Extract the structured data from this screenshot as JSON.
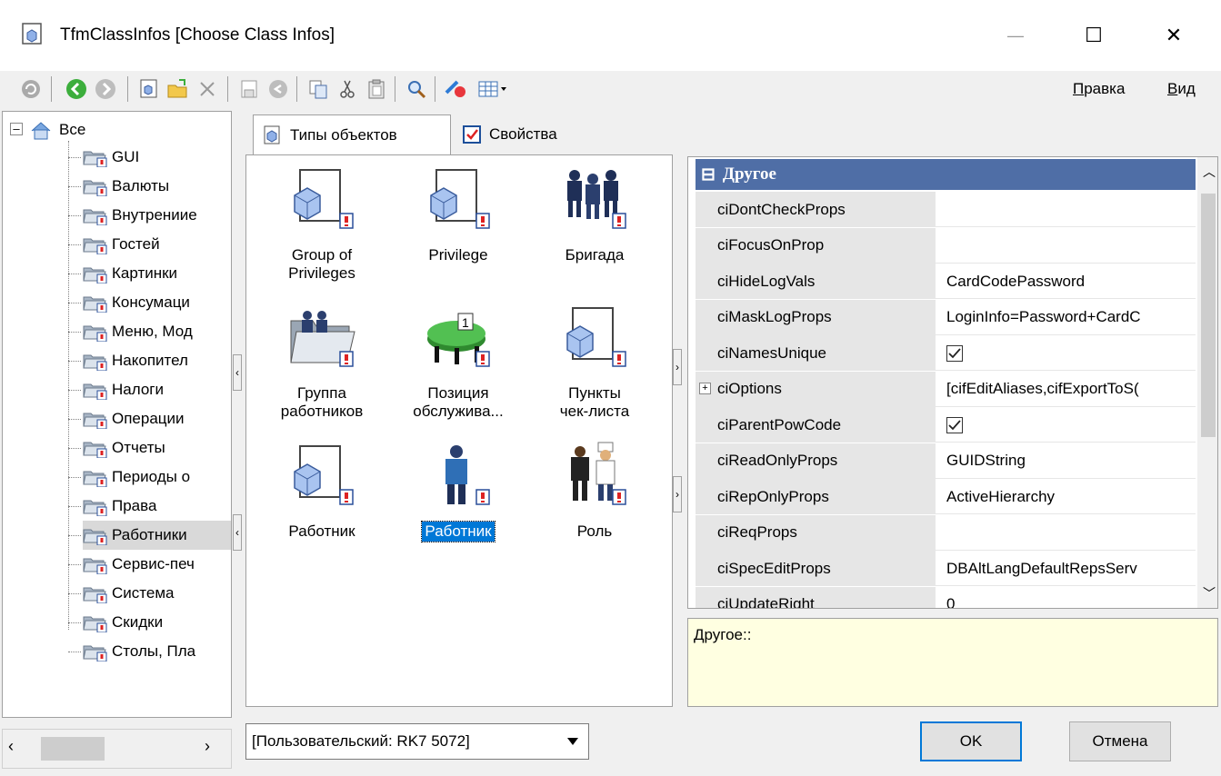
{
  "window": {
    "title": "TfmClassInfos [Choose Class Infos]",
    "minimize_glyph": "—",
    "maximize_glyph": "☐",
    "close_glyph": "✕"
  },
  "toolbar": {
    "buttons": [
      {
        "icon": "refresh-icon"
      },
      {
        "icon": "back-icon"
      },
      {
        "icon": "forward-icon"
      },
      {
        "icon": "class-object-icon"
      },
      {
        "icon": "open-folder-icon"
      },
      {
        "icon": "delete-icon"
      },
      {
        "icon": "save-icon"
      },
      {
        "icon": "undo-icon"
      },
      {
        "icon": "copy-icon"
      },
      {
        "icon": "cut-icon"
      },
      {
        "icon": "paste-icon"
      },
      {
        "icon": "find-icon"
      },
      {
        "icon": "paint-icon"
      },
      {
        "icon": "view-grid-icon"
      }
    ],
    "menu_edit_hotkey": "П",
    "menu_edit_rest": "равка",
    "menu_view_hotkey": "В",
    "menu_view_rest": "ид"
  },
  "tree": {
    "root": {
      "label": "Все"
    },
    "items": [
      {
        "label": "GUI"
      },
      {
        "label": "Валюты"
      },
      {
        "label": "Внутрениие"
      },
      {
        "label": "Гостей"
      },
      {
        "label": "Картинки"
      },
      {
        "label": "Консумаци"
      },
      {
        "label": "Меню, Мод"
      },
      {
        "label": "Накопител"
      },
      {
        "label": "Налоги"
      },
      {
        "label": "Операции"
      },
      {
        "label": "Отчеты"
      },
      {
        "label": "Периоды о"
      },
      {
        "label": "Права"
      },
      {
        "label": "Работники",
        "selected": true
      },
      {
        "label": "Сервис-печ"
      },
      {
        "label": "Система"
      },
      {
        "label": "Скидки"
      },
      {
        "label": "Столы, Пла"
      }
    ]
  },
  "tabs": [
    {
      "label": "Типы объектов",
      "active": true,
      "icon": "class-object-icon"
    },
    {
      "label": "Свойства",
      "active": false,
      "icon": "properties-icon"
    }
  ],
  "objects": [
    {
      "line1": "Group of",
      "line2": "Privileges",
      "icon": "class-object-icon"
    },
    {
      "line1": "Privilege",
      "line2": "",
      "icon": "class-object-icon"
    },
    {
      "line1": "Бригада",
      "line2": "",
      "icon": "team-icon"
    },
    {
      "line1": "Группа",
      "line2": "работников",
      "icon": "employee-group-folder-icon"
    },
    {
      "line1": "Позиция",
      "line2": "обслужива...",
      "icon": "service-table-icon"
    },
    {
      "line1": "Пункты",
      "line2": "чек-листа",
      "icon": "class-object-icon"
    },
    {
      "line1": "Работник",
      "line2": "",
      "icon": "class-object-icon"
    },
    {
      "line1": "Работник",
      "line2": "",
      "icon": "worker-icon",
      "selected": true
    },
    {
      "line1": "Роль",
      "line2": "",
      "icon": "role-people-icon"
    }
  ],
  "properties": {
    "category": "Другое",
    "category_glyph": "⊟",
    "rows": [
      {
        "name": "ciDontCheckProps",
        "value": ""
      },
      {
        "name": "ciFocusOnProp",
        "value": ""
      },
      {
        "name": "ciHideLogVals",
        "value": "CardCodePassword"
      },
      {
        "name": "ciMaskLogProps",
        "value": "LoginInfo=Password+CardC"
      },
      {
        "name": "ciNamesUnique",
        "value": "",
        "checkbox": true
      },
      {
        "name": "ciOptions",
        "value": "[cifEditAliases,cifExportToS(",
        "expandable": true
      },
      {
        "name": "ciParentPowCode",
        "value": "",
        "checkbox": true
      },
      {
        "name": "ciReadOnlyProps",
        "value": "GUIDString"
      },
      {
        "name": "ciRepOnlyProps",
        "value": "ActiveHierarchy"
      },
      {
        "name": "ciReqProps",
        "value": ""
      },
      {
        "name": "ciSpecEditProps",
        "value": "DBAltLangDefaultRepsServ"
      },
      {
        "name": "ciUpdateRight",
        "value": "0"
      }
    ],
    "description": "Другое::"
  },
  "bottom": {
    "combo_value": "[Пользовательский: RK7 5072]",
    "ok_label": "OK",
    "cancel_label": "Отмена"
  },
  "colors": {
    "category_bg": "#4f6ea6",
    "selection": "#0078d7",
    "description_bg": "#ffffe1",
    "name_column_bg": "#e6e6e6"
  }
}
